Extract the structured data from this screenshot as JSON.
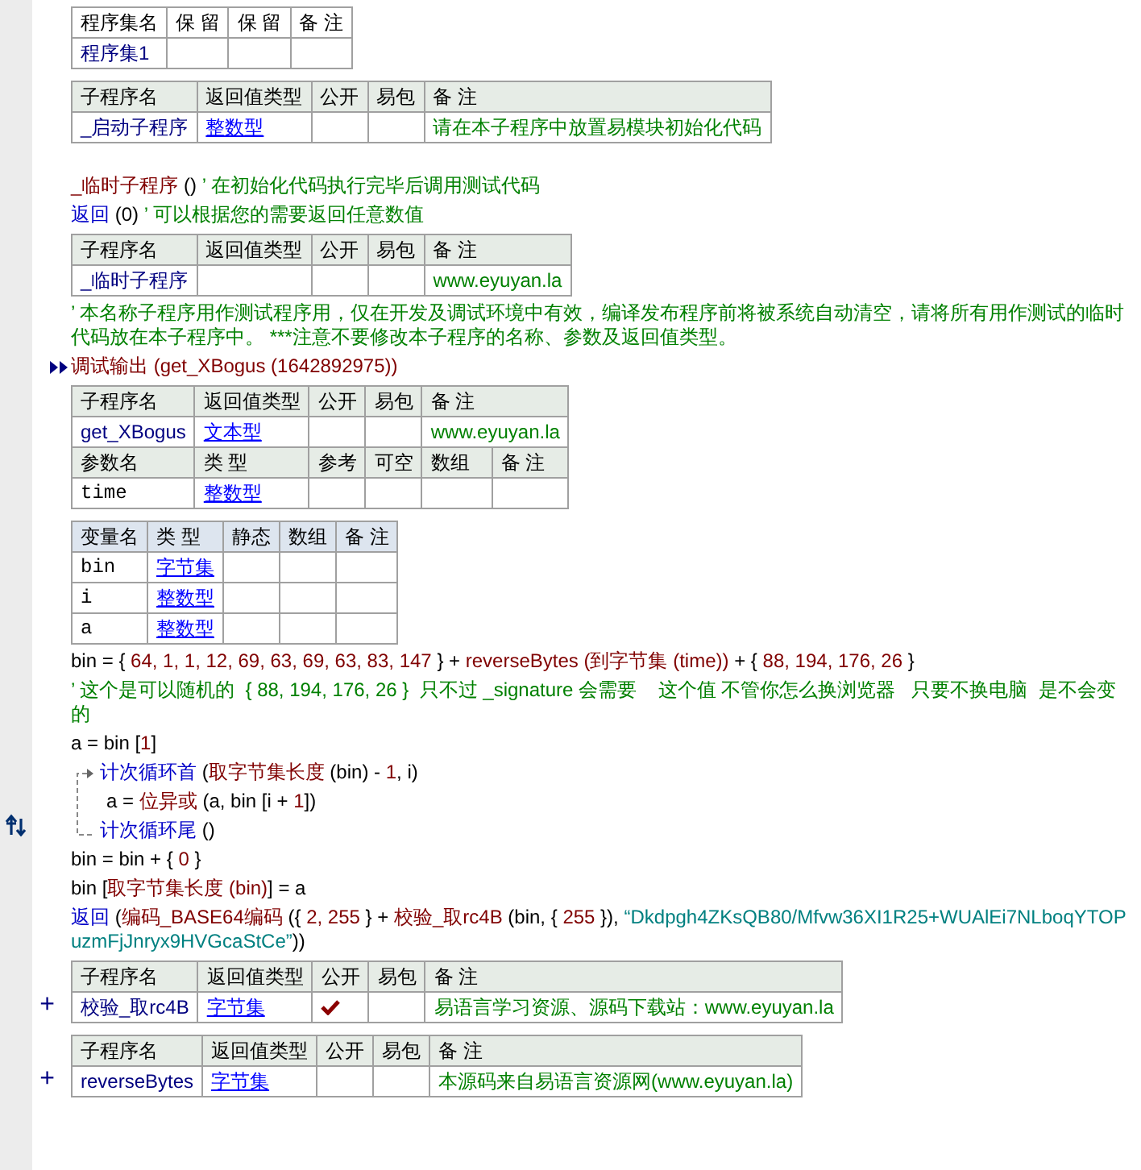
{
  "blocks": [
    {
      "kind": "assembly_table",
      "rows": [
        {
          "cells": [
            {
              "kind": "header",
              "text": "程序集名"
            },
            {
              "kind": "header",
              "text": "保 留"
            },
            {
              "kind": "header",
              "text": "保 留"
            },
            {
              "kind": "header",
              "text": "备 注"
            }
          ]
        },
        {
          "cells": [
            {
              "kind": "name",
              "text": "程序集1"
            },
            {
              "kind": "empty"
            },
            {
              "kind": "empty"
            },
            {
              "kind": "empty"
            }
          ]
        }
      ]
    },
    {
      "kind": "subroutine_table",
      "rows": [
        {
          "cells": [
            {
              "kind": "header",
              "text": "子程序名"
            },
            {
              "kind": "header",
              "text": "返回值类型"
            },
            {
              "kind": "header",
              "text": "公开"
            },
            {
              "kind": "header",
              "text": "易包"
            },
            {
              "kind": "header",
              "text": "备 注"
            }
          ]
        },
        {
          "cells": [
            {
              "kind": "name",
              "text": "_启动子程序"
            },
            {
              "kind": "type",
              "text": "整数型"
            },
            {
              "kind": "flag",
              "checked": false
            },
            {
              "kind": "flag",
              "checked": false
            },
            {
              "kind": "note",
              "text": "请在本子程序中放置易模块初始化代码"
            }
          ]
        }
      ]
    },
    {
      "kind": "blank"
    },
    {
      "kind": "line",
      "segments": [
        {
          "kind": "call",
          "text": "_临时子程序"
        },
        {
          "kind": "plain",
          "text": " () "
        },
        {
          "kind": "comment",
          "text": "’ 在初始化代码执行完毕后调用测试代码"
        }
      ]
    },
    {
      "kind": "line",
      "segments": [
        {
          "kind": "keyword",
          "text": "返回"
        },
        {
          "kind": "plain",
          "text": " (0) "
        },
        {
          "kind": "comment",
          "text": "’ 可以根据您的需要返回任意数值"
        }
      ]
    },
    {
      "kind": "subroutine_table",
      "rows": [
        {
          "cells": [
            {
              "kind": "header",
              "text": "子程序名"
            },
            {
              "kind": "header",
              "text": "返回值类型"
            },
            {
              "kind": "header",
              "text": "公开"
            },
            {
              "kind": "header",
              "text": "易包"
            },
            {
              "kind": "header",
              "text": "备 注"
            }
          ]
        },
        {
          "cells": [
            {
              "kind": "name",
              "text": "_临时子程序"
            },
            {
              "kind": "empty"
            },
            {
              "kind": "flag",
              "checked": false
            },
            {
              "kind": "flag",
              "checked": false
            },
            {
              "kind": "note",
              "text": "www.eyuyan.la"
            }
          ]
        }
      ]
    },
    {
      "kind": "line",
      "segments": [
        {
          "kind": "comment",
          "text": "’ 本名称子程序用作测试程序用，仅在开发及调试环境中有效，编译发布程序前将被系统自动清空，请将所有用作测试的临时代码放在本子程序中。 ***注意不要修改本子程序的名称、参数及返回值类型。"
        }
      ]
    },
    {
      "kind": "marked_line",
      "segments": [
        {
          "kind": "call",
          "text": "调试输出 (get_XBogus (1642892975))"
        }
      ]
    },
    {
      "kind": "subroutine_table",
      "rows": [
        {
          "cells": [
            {
              "kind": "header",
              "text": "子程序名"
            },
            {
              "kind": "header",
              "text": "返回值类型"
            },
            {
              "kind": "header",
              "text": "公开"
            },
            {
              "kind": "header",
              "text": "易包"
            },
            {
              "kind": "header",
              "text": "备 注",
              "colspan": 2
            }
          ]
        },
        {
          "cells": [
            {
              "kind": "name",
              "text": "get_XBogus"
            },
            {
              "kind": "type",
              "text": "文本型"
            },
            {
              "kind": "flag",
              "checked": false
            },
            {
              "kind": "flag",
              "checked": false
            },
            {
              "kind": "note",
              "text": "www.eyuyan.la",
              "colspan": 2
            }
          ]
        },
        {
          "cells": [
            {
              "kind": "header",
              "text": "参数名"
            },
            {
              "kind": "header",
              "text": "类 型"
            },
            {
              "kind": "header",
              "text": "参考"
            },
            {
              "kind": "header",
              "text": "可空"
            },
            {
              "kind": "header",
              "text": "数组"
            },
            {
              "kind": "header",
              "text": "备 注"
            }
          ]
        },
        {
          "cells": [
            {
              "kind": "plain",
              "text": "time"
            },
            {
              "kind": "type",
              "text": "整数型"
            },
            {
              "kind": "flag",
              "checked": false
            },
            {
              "kind": "flag",
              "checked": false
            },
            {
              "kind": "flag",
              "checked": false
            },
            {
              "kind": "empty"
            }
          ]
        }
      ]
    },
    {
      "kind": "variable_table",
      "rows": [
        {
          "cells": [
            {
              "kind": "header",
              "text": "变量名"
            },
            {
              "kind": "header",
              "text": "类 型"
            },
            {
              "kind": "header",
              "text": "静态"
            },
            {
              "kind": "header",
              "text": "数组"
            },
            {
              "kind": "header",
              "text": "备 注"
            }
          ]
        },
        {
          "cells": [
            {
              "kind": "plain",
              "text": "bin"
            },
            {
              "kind": "type",
              "text": "字节集"
            },
            {
              "kind": "flag",
              "checked": false
            },
            {
              "kind": "flag",
              "checked": false
            },
            {
              "kind": "empty"
            }
          ]
        },
        {
          "cells": [
            {
              "kind": "plain",
              "text": "i"
            },
            {
              "kind": "type",
              "text": "整数型"
            },
            {
              "kind": "flag",
              "checked": false
            },
            {
              "kind": "flag",
              "checked": false
            },
            {
              "kind": "empty"
            }
          ]
        },
        {
          "cells": [
            {
              "kind": "plain",
              "text": "a"
            },
            {
              "kind": "type",
              "text": "整数型"
            },
            {
              "kind": "flag",
              "checked": false
            },
            {
              "kind": "flag",
              "checked": false
            },
            {
              "kind": "empty"
            }
          ]
        }
      ]
    },
    {
      "kind": "line",
      "segments": [
        {
          "kind": "plain",
          "text": "bin = { "
        },
        {
          "kind": "number",
          "text": "64, 1, 1, 12, 69, 63, 69, 63, 83, 147"
        },
        {
          "kind": "plain",
          "text": " } + "
        },
        {
          "kind": "call",
          "text": "reverseBytes (到字节集 (time))"
        },
        {
          "kind": "plain",
          "text": " + { "
        },
        {
          "kind": "number",
          "text": "88, 194, 176, 26"
        },
        {
          "kind": "plain",
          "text": " }"
        }
      ]
    },
    {
      "kind": "line",
      "segments": [
        {
          "kind": "comment",
          "text": "’ 这个是可以随机的  { 88, 194, 176, 26 }  只不过 _signature 会需要    这个值 不管你怎么换浏览器   只要不换电脑  是不会变的"
        }
      ]
    },
    {
      "kind": "line",
      "segments": [
        {
          "kind": "plain",
          "text": "a = bin ["
        },
        {
          "kind": "number",
          "text": "1"
        },
        {
          "kind": "plain",
          "text": "]"
        }
      ]
    },
    {
      "kind": "loop",
      "head": [
        {
          "kind": "keyword",
          "text": "计次循环首"
        },
        {
          "kind": "plain",
          "text": " ("
        },
        {
          "kind": "call",
          "text": "取字节集长度"
        },
        {
          "kind": "plain",
          "text": " (bin) - "
        },
        {
          "kind": "number",
          "text": "1"
        },
        {
          "kind": "plain",
          "text": ", i)"
        }
      ],
      "children": [
        {
          "kind": "line",
          "segments": [
            {
              "kind": "plain",
              "text": "a = "
            },
            {
              "kind": "call",
              "text": "位异或"
            },
            {
              "kind": "plain",
              "text": " (a, bin [i + "
            },
            {
              "kind": "number",
              "text": "1"
            },
            {
              "kind": "plain",
              "text": "])"
            }
          ]
        }
      ],
      "tail": [
        {
          "kind": "keyword",
          "text": "计次循环尾"
        },
        {
          "kind": "plain",
          "text": " ()"
        }
      ]
    },
    {
      "kind": "line",
      "segments": [
        {
          "kind": "plain",
          "text": "bin = bin + { "
        },
        {
          "kind": "number",
          "text": "0"
        },
        {
          "kind": "plain",
          "text": " }"
        }
      ]
    },
    {
      "kind": "line",
      "segments": [
        {
          "kind": "plain",
          "text": "bin ["
        },
        {
          "kind": "call",
          "text": "取字节集长度 (bin)"
        },
        {
          "kind": "plain",
          "text": "] = a"
        }
      ]
    },
    {
      "kind": "line",
      "segments": [
        {
          "kind": "keyword",
          "text": "返回"
        },
        {
          "kind": "plain",
          "text": " ("
        },
        {
          "kind": "call",
          "text": "编码_BASE64编码"
        },
        {
          "kind": "plain",
          "text": " ({ "
        },
        {
          "kind": "number",
          "text": "2, 255"
        },
        {
          "kind": "plain",
          "text": " } + "
        },
        {
          "kind": "call",
          "text": "校验_取rc4B"
        },
        {
          "kind": "plain",
          "text": " (bin, { "
        },
        {
          "kind": "number",
          "text": "255"
        },
        {
          "kind": "plain",
          "text": " }), "
        },
        {
          "kind": "string",
          "text": "“Dkdpgh4ZKsQB80/Mfvw36XI1R25+WUAlEi7NLboqYTOPuzmFjJnryx9HVGcaStCe”"
        },
        {
          "kind": "plain",
          "text": "))"
        }
      ]
    },
    {
      "kind": "subroutine_table",
      "expander": "+",
      "rows": [
        {
          "cells": [
            {
              "kind": "header",
              "text": "子程序名"
            },
            {
              "kind": "header",
              "text": "返回值类型"
            },
            {
              "kind": "header",
              "text": "公开"
            },
            {
              "kind": "header",
              "text": "易包"
            },
            {
              "kind": "header",
              "text": "备 注"
            }
          ]
        },
        {
          "cells": [
            {
              "kind": "name",
              "text": "校验_取rc4B"
            },
            {
              "kind": "type",
              "text": "字节集"
            },
            {
              "kind": "flag",
              "checked": true
            },
            {
              "kind": "flag",
              "checked": false
            },
            {
              "kind": "note",
              "text": "易语言学习资源、源码下载站：www.eyuyan.la"
            }
          ]
        }
      ]
    },
    {
      "kind": "subroutine_table",
      "expander": "+",
      "rows": [
        {
          "cells": [
            {
              "kind": "header",
              "text": "子程序名"
            },
            {
              "kind": "header",
              "text": "返回值类型"
            },
            {
              "kind": "header",
              "text": "公开"
            },
            {
              "kind": "header",
              "text": "易包"
            },
            {
              "kind": "header",
              "text": "备 注"
            }
          ]
        },
        {
          "cells": [
            {
              "kind": "name",
              "text": "reverseBytes"
            },
            {
              "kind": "type",
              "text": "字节集"
            },
            {
              "kind": "flag",
              "checked": false
            },
            {
              "kind": "flag",
              "checked": false
            },
            {
              "kind": "note",
              "text": "本源码来自易语言资源网(www.eyuyan.la)"
            }
          ]
        }
      ]
    }
  ]
}
